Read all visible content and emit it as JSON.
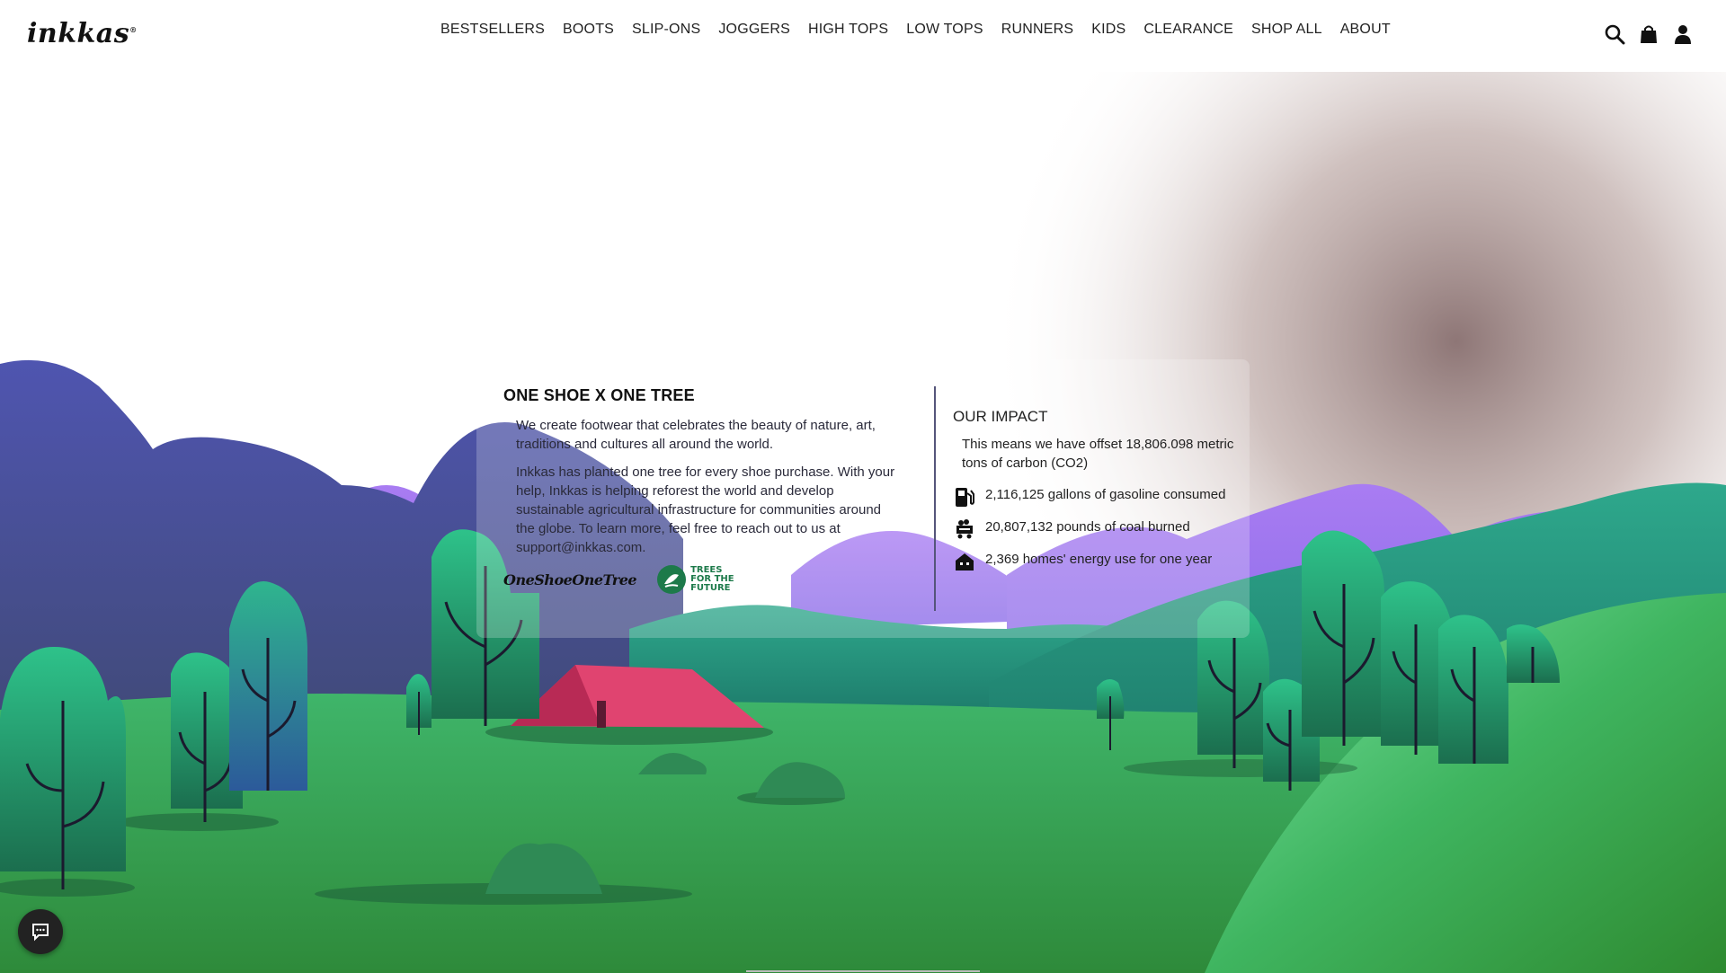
{
  "brand": {
    "logo_text": "inkkas",
    "logo_mark": "®"
  },
  "nav": {
    "items": [
      {
        "label": "BESTSELLERS"
      },
      {
        "label": "BOOTS"
      },
      {
        "label": "SLIP-ONS"
      },
      {
        "label": "JOGGERS"
      },
      {
        "label": "HIGH TOPS"
      },
      {
        "label": "LOW TOPS"
      },
      {
        "label": "RUNNERS"
      },
      {
        "label": "KIDS"
      },
      {
        "label": "CLEARANCE"
      },
      {
        "label": "SHOP ALL"
      },
      {
        "label": "ABOUT"
      }
    ]
  },
  "header_icons": [
    "search-icon",
    "shopping-bag-icon",
    "account-icon"
  ],
  "panel": {
    "title": "ONE SHOE X ONE TREE",
    "intro": "We create footwear that celebrates the beauty of nature, art, traditions and cultures all around the world.",
    "body": "Inkkas has planted one tree for every shoe purchase. With your help, Inkkas is helping reforest the world and develop sustainable agricultural infrastructure for communities around the globe. To learn more, feel free to reach out to us at support@inkkas.com.",
    "badge_oneshoe": "OneShoeOneTree",
    "badge_tftf": "TREES FOR THE FUTURE"
  },
  "impact": {
    "heading": "OUR IMPACT",
    "lead": "This means we have offset 18,806.098 metric tons of carbon (CO2)",
    "stats": [
      {
        "icon": "gas-pump-icon",
        "text": "2,116,125 gallons of gasoline consumed"
      },
      {
        "icon": "coal-cart-icon",
        "text": "20,807,132 pounds of coal burned"
      },
      {
        "icon": "house-icon",
        "text": "2,369 homes' energy use for one year"
      }
    ]
  },
  "colors": {
    "sky_purple": "#8b6cf0",
    "mountain_blue": "#4a4ea0",
    "grass_green": "#34a85a",
    "tree_teal": "#1f9a78",
    "tent_red": "#d93a62"
  }
}
